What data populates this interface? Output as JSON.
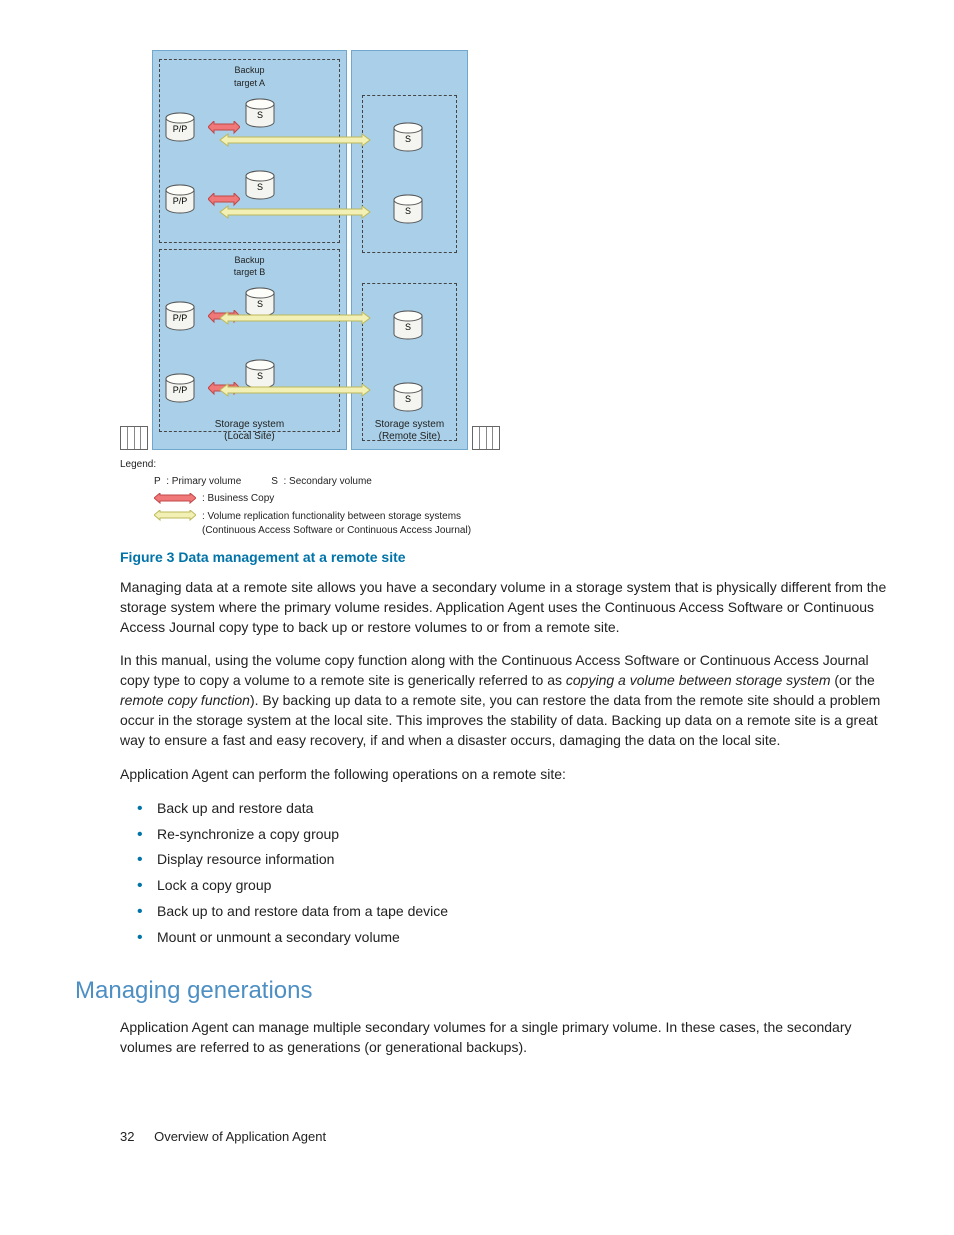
{
  "diagram": {
    "local": {
      "groupA_title": "Backup\ntarget A",
      "groupB_title": "Backup\ntarget B",
      "pp_label": "P/P",
      "s_label": "S",
      "site_label": "Storage system\n(Local Site)"
    },
    "remote": {
      "s_label": "S",
      "site_label": "Storage system\n(Remote Site)"
    },
    "legend": {
      "title": "Legend:",
      "p_label": "P",
      "p_desc": ": Primary volume",
      "s_label": "S",
      "s_desc": ": Secondary volume",
      "bc_desc": ": Business Copy",
      "rep_desc": ": Volume replication functionality between storage systems\n(Continuous Access Software or Continuous Access Journal)"
    }
  },
  "figure_caption": "Figure 3 Data management at a remote site",
  "para1": "Managing data at a remote site allows you have a secondary volume in a storage system that is physically different from the storage system where the primary volume resides. Application Agent uses the Continuous Access Software or Continuous Access Journal copy type to back up or restore volumes to or from a remote site.",
  "para2a": "In this manual, using the volume copy function along with the Continuous Access Software or Continuous Access Journal copy type to copy a volume to a remote site is generically referred to as ",
  "para2b_italic": "copying a volume between storage system",
  "para2c": " (or the ",
  "para2d_italic": "remote copy function",
  "para2e": "). By backing up data to a remote site, you can restore the data from the remote site should a problem occur in the storage system at the local site. This improves the stability of data. Backing up data on a remote site is a great way to ensure a fast and easy recovery, if and when a disaster occurs, damaging the data on the local site.",
  "para3": "Application Agent can perform the following operations on a remote site:",
  "ops": [
    "Back up and restore data",
    "Re-synchronize a copy group",
    "Display resource information",
    "Lock a copy group",
    "Back up to and restore data from a tape device",
    "Mount or unmount a secondary volume"
  ],
  "section_heading": "Managing generations",
  "para4": "Application Agent can manage multiple secondary volumes for a single primary volume. In these cases, the secondary volumes are referred to as generations (or generational backups).",
  "footer": {
    "page": "32",
    "title": "Overview of Application Agent"
  }
}
